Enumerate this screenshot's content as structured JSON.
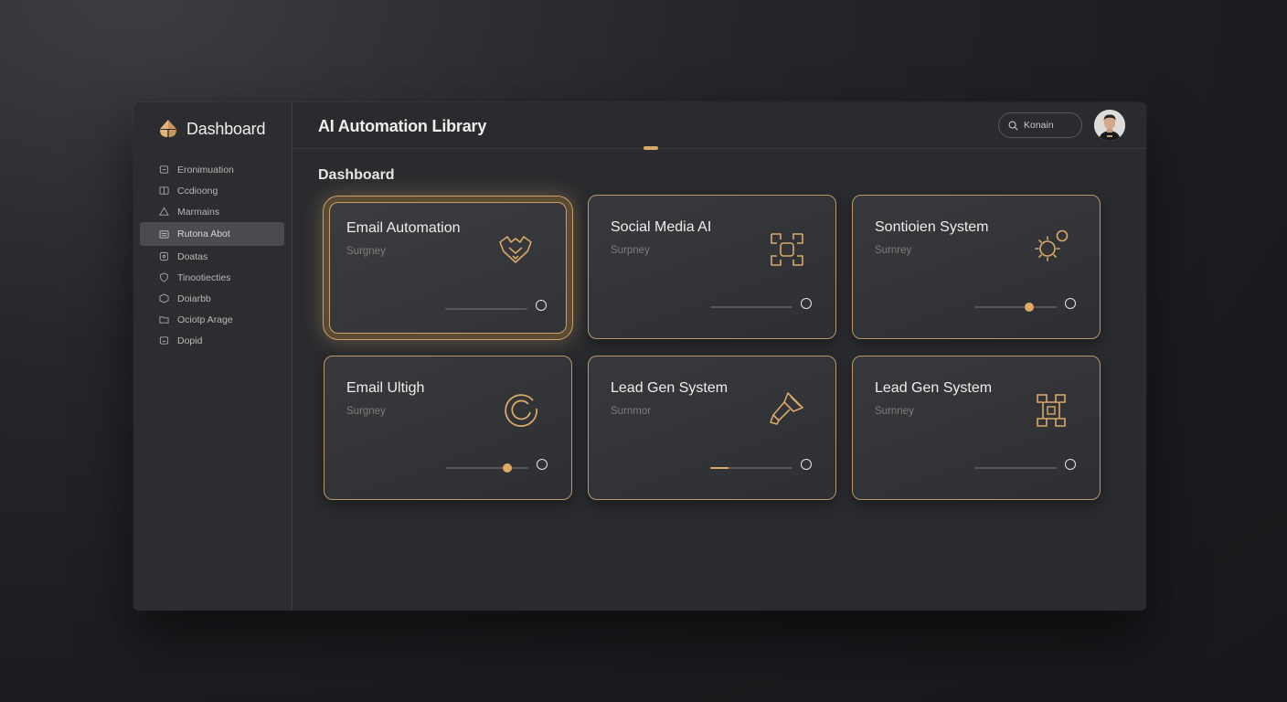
{
  "brand": {
    "name": "Dashboard"
  },
  "sidebar": {
    "items": [
      {
        "label": "Eronimuation",
        "icon": "archive-icon",
        "active": false
      },
      {
        "label": "Ccdioong",
        "icon": "book-icon",
        "active": false
      },
      {
        "label": "Marmains",
        "icon": "alert-triangle-icon",
        "active": false
      },
      {
        "label": "Rutona Abot",
        "icon": "list-icon",
        "active": true
      },
      {
        "label": "Doatas",
        "icon": "grid-icon",
        "active": false
      },
      {
        "label": "Tinootiecties",
        "icon": "shield-icon",
        "active": false
      },
      {
        "label": "Doiarbb",
        "icon": "box-icon",
        "active": false
      },
      {
        "label": "Ociotp Arage",
        "icon": "folder-icon",
        "active": false
      },
      {
        "label": "Dopid",
        "icon": "tag-icon",
        "active": false
      }
    ]
  },
  "header": {
    "title": "AI Automation Library",
    "search_value": "Konain"
  },
  "main": {
    "section_title": "Dashboard",
    "cards": [
      {
        "title": "Email Automation",
        "subtitle": "Surgney",
        "icon": "fox-head-icon",
        "slider_value": 0,
        "selected": true
      },
      {
        "title": "Social Media AI",
        "subtitle": "Surpney",
        "icon": "nodes-network-icon",
        "slider_value": 0,
        "selected": false
      },
      {
        "title": "Sontioien System",
        "subtitle": "Surnrey",
        "icon": "sun-gear-icon",
        "slider_value": 0.6,
        "selected": false
      },
      {
        "title": "Email Ultigh",
        "subtitle": "Surgney",
        "icon": "circular-refresh-icon",
        "slider_value": 0.7,
        "selected": false
      },
      {
        "title": "Lead Gen System",
        "subtitle": "Surnmor",
        "icon": "magic-wand-icon",
        "slider_value": 0.2,
        "selected": false
      },
      {
        "title": "Lead Gen System",
        "subtitle": "Surnney",
        "icon": "circuit-chip-icon",
        "slider_value": 0,
        "selected": false
      }
    ]
  },
  "colors": {
    "accent": "#d9a96a",
    "border": "#b89868",
    "background": "#2a2b2e"
  }
}
